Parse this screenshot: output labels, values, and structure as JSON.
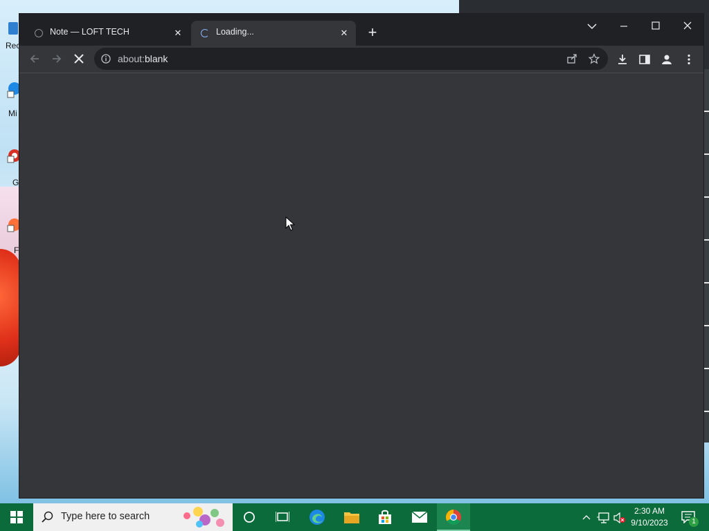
{
  "desktop": {
    "icon_labels": [
      "Rec",
      "Mi",
      "G",
      "F"
    ]
  },
  "browser": {
    "tabs": [
      {
        "title": "Note — LOFT TECH",
        "state": "inactive"
      },
      {
        "title": "Loading...",
        "state": "active"
      }
    ],
    "address": {
      "scheme": "about:",
      "path": "blank"
    },
    "colors": {
      "frame": "#202124",
      "toolbar": "#35363a",
      "content": "#35363a",
      "accent": "#8ab4f8"
    }
  },
  "taskbar": {
    "search_placeholder": "Type here to search",
    "clock_time": "2:30 AM",
    "clock_date": "9/10/2023",
    "notification_count": "1",
    "colors": {
      "background": "#0b6b3a",
      "active": "#1d8550"
    }
  }
}
